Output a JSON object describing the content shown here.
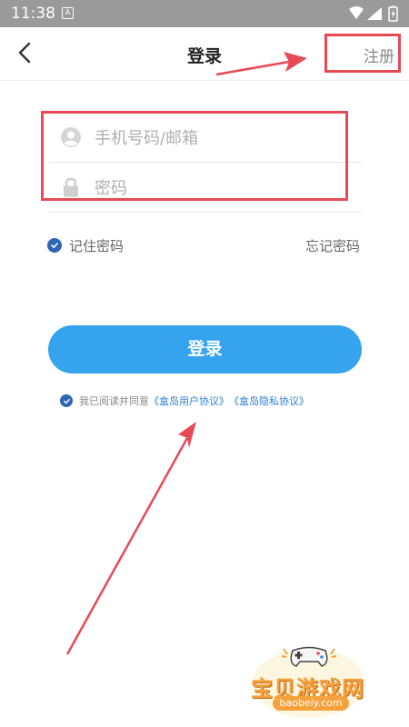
{
  "status_bar": {
    "time": "11:38",
    "notification_glyph": "A"
  },
  "header": {
    "title": "登录",
    "register_label": "注册"
  },
  "form": {
    "phone_placeholder": "手机号码/邮箱",
    "password_placeholder": "密码"
  },
  "options": {
    "remember_label": "记住密码",
    "forgot_label": "忘记密码"
  },
  "login_button": "登录",
  "agreement": {
    "prefix": "我已阅读并同意",
    "user_agreement": "《盒岛用户协议》",
    "privacy_agreement": "《盒岛隐私协议》"
  },
  "watermark": {
    "title": "宝贝游戏网",
    "url": "baobeiy.com"
  },
  "colors": {
    "accent": "#36a3ee",
    "check": "#2e65b6",
    "annotation": "#e84a55",
    "link": "#2e7fd1",
    "watermark": "#f6a23c"
  }
}
